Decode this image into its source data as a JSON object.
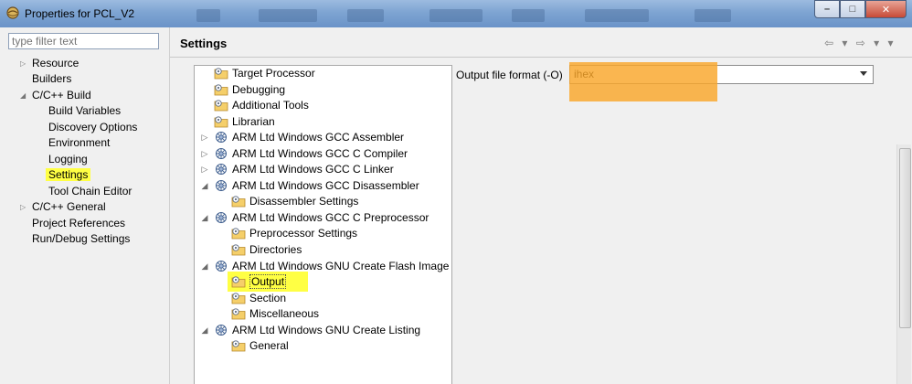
{
  "window": {
    "title": "Properties for PCL_V2",
    "buttons": {
      "minimize": "–",
      "maximize": "□",
      "close": "✕"
    }
  },
  "filter": {
    "placeholder": "type filter text"
  },
  "nav": [
    {
      "label": "Resource",
      "twisty": "▷"
    },
    {
      "label": "Builders",
      "twisty": ""
    },
    {
      "label": "C/C++ Build",
      "twisty": "◢"
    },
    {
      "label": "Build Variables",
      "twisty": ""
    },
    {
      "label": "Discovery Options",
      "twisty": ""
    },
    {
      "label": "Environment",
      "twisty": ""
    },
    {
      "label": "Logging",
      "twisty": ""
    },
    {
      "label": "Settings",
      "twisty": ""
    },
    {
      "label": "Tool Chain Editor",
      "twisty": ""
    },
    {
      "label": "C/C++ General",
      "twisty": "▷"
    },
    {
      "label": "Project References",
      "twisty": ""
    },
    {
      "label": "Run/Debug Settings",
      "twisty": ""
    }
  ],
  "header": {
    "title": "Settings",
    "nav_arrows": "⇦ ▾ ⇨ ▾ ▾"
  },
  "tools": [
    {
      "label": "Target Processor",
      "twisty": "",
      "icon": "folder-gear-icon"
    },
    {
      "label": "Debugging",
      "twisty": "",
      "icon": "folder-gear-icon"
    },
    {
      "label": "Additional Tools",
      "twisty": "",
      "icon": "folder-gear-icon"
    },
    {
      "label": "Librarian",
      "twisty": "",
      "icon": "folder-gear-icon"
    },
    {
      "label": "ARM Ltd Windows GCC Assembler",
      "twisty": "▷",
      "icon": "tool-gear-icon"
    },
    {
      "label": "ARM Ltd Windows GCC C Compiler",
      "twisty": "▷",
      "icon": "tool-gear-icon"
    },
    {
      "label": "ARM Ltd Windows GCC C Linker",
      "twisty": "▷",
      "icon": "tool-gear-icon"
    },
    {
      "label": "ARM Ltd Windows GCC Disassembler",
      "twisty": "◢",
      "icon": "tool-gear-icon"
    },
    {
      "label": "Disassembler Settings",
      "twisty": "",
      "icon": "folder-gear-icon"
    },
    {
      "label": "ARM Ltd Windows GCC C Preprocessor",
      "twisty": "◢",
      "icon": "tool-gear-icon"
    },
    {
      "label": "Preprocessor Settings",
      "twisty": "",
      "icon": "folder-gear-icon"
    },
    {
      "label": "Directories",
      "twisty": "",
      "icon": "folder-gear-icon"
    },
    {
      "label": "ARM Ltd Windows GNU Create Flash Image",
      "twisty": "◢",
      "icon": "tool-gear-icon"
    },
    {
      "label": "Output",
      "twisty": "",
      "icon": "folder-gear-icon"
    },
    {
      "label": "Section",
      "twisty": "",
      "icon": "folder-gear-icon"
    },
    {
      "label": "Miscellaneous",
      "twisty": "",
      "icon": "folder-gear-icon"
    },
    {
      "label": "ARM Ltd Windows GNU Create Listing",
      "twisty": "◢",
      "icon": "tool-gear-icon"
    },
    {
      "label": "General",
      "twisty": "",
      "icon": "folder-gear-icon"
    }
  ],
  "output_setting": {
    "label": "Output file format (-O)",
    "value": "ihex"
  },
  "colors": {
    "highlight": "#ffff44",
    "annotation": "#f9a62a"
  }
}
